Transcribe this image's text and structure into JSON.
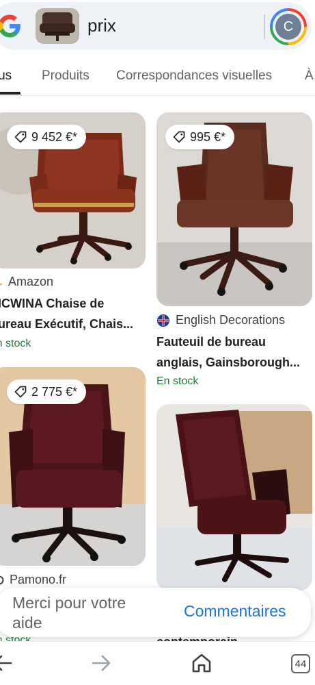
{
  "search": {
    "query": "prix",
    "avatar_letter": "C"
  },
  "tabs": [
    {
      "label": "Tous"
    },
    {
      "label": "Produits"
    },
    {
      "label": "Correspondances visuelles"
    },
    {
      "label": "À"
    }
  ],
  "results": [
    {
      "price": "9 452 €*",
      "source": "Amazon",
      "title_line1": "INCWINA Chaise de",
      "title_line2": "Bureau Exécutif, Chais...",
      "stock": "En stock"
    },
    {
      "price": "995 €*",
      "source": "English Decorations",
      "title_line1": "Fauteuil de bureau",
      "title_line2": "anglais, Gainsborough...",
      "stock": "En stock"
    },
    {
      "price": "2 775 €*",
      "source": "Pamono.fr",
      "stock": "En stock"
    },
    {
      "title_line1": "contemporain"
    }
  ],
  "feedback": {
    "text": "Merci pour votre aide",
    "button": "Commentaires"
  },
  "bottom_nav": {
    "tab_count": "44",
    "icons": [
      "back-arrow-icon",
      "forward-arrow-icon",
      "home-icon",
      "tab-switcher-icon"
    ]
  },
  "colors": {
    "link_blue": "#1a73e8",
    "stock_green": "#188038",
    "search_bg": "#eef1f5"
  }
}
